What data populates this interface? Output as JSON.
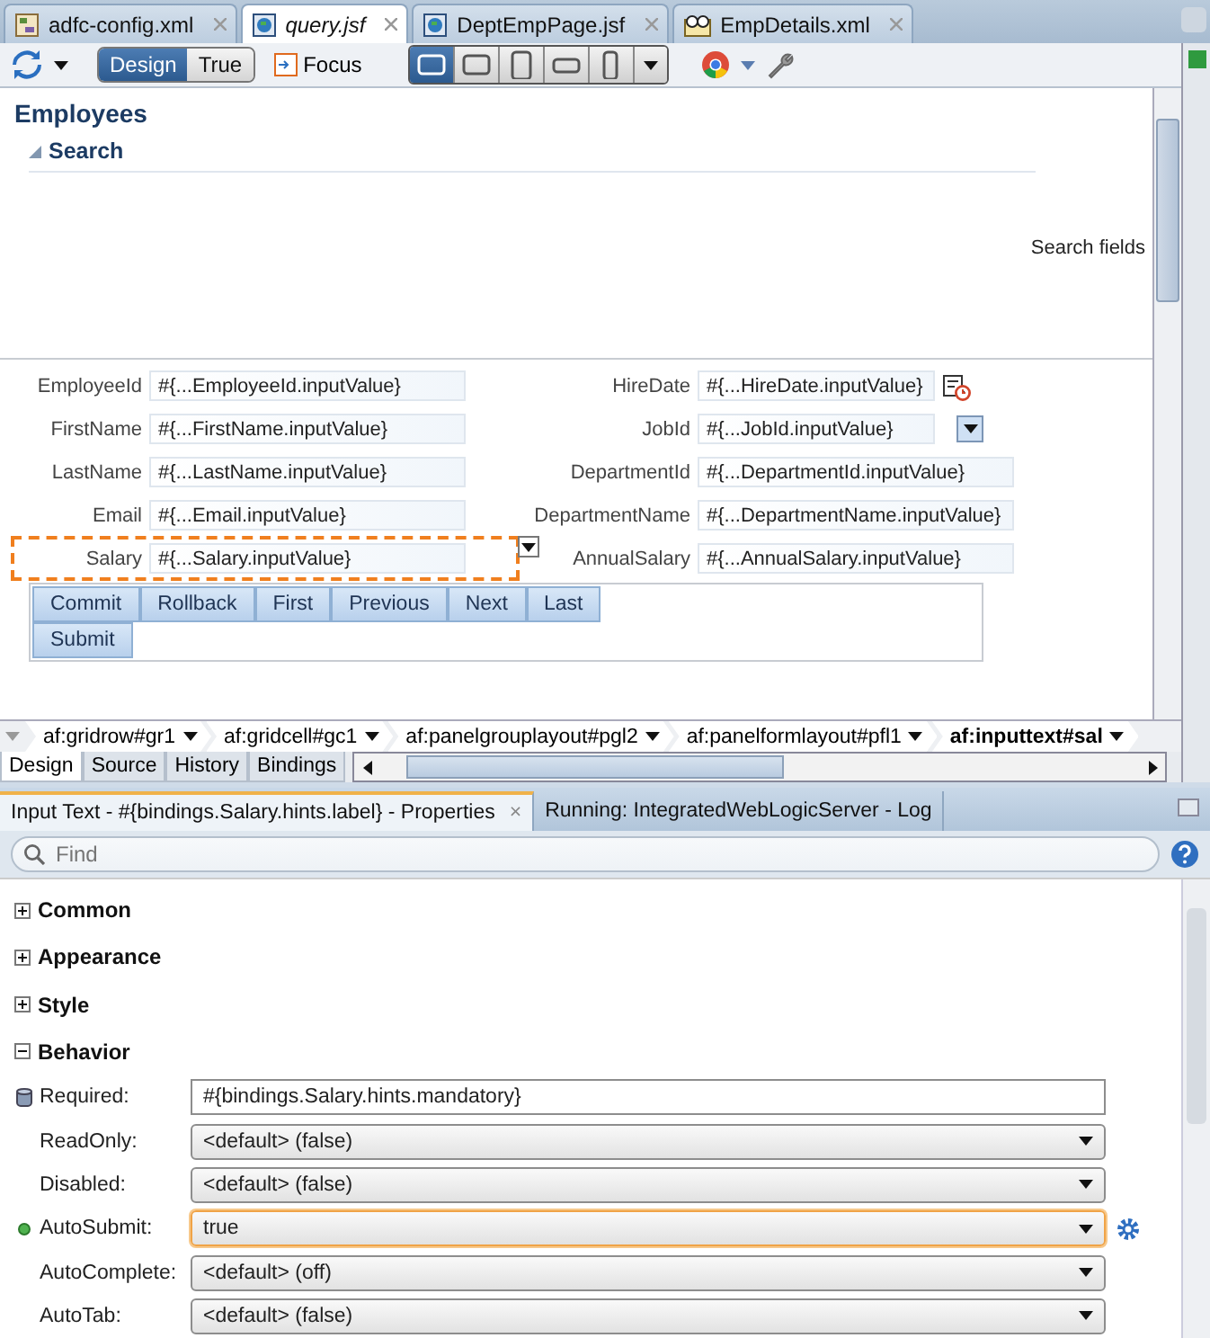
{
  "editor_tabs": [
    {
      "label": "adfc-config.xml",
      "kind": "config",
      "selected": false,
      "modified": false
    },
    {
      "label": "query.jsf",
      "kind": "page",
      "selected": true,
      "modified": true
    },
    {
      "label": "DeptEmpPage.jsf",
      "kind": "page",
      "selected": false,
      "modified": false
    },
    {
      "label": "EmpDetails.xml",
      "kind": "xml",
      "selected": false,
      "modified": false
    }
  ],
  "toolbar": {
    "mode_toggle": [
      {
        "label": "Design",
        "selected": true
      },
      {
        "label": "True",
        "selected": false
      }
    ],
    "focus_label": "Focus",
    "devices": [
      {
        "kind": "desktop",
        "selected": true
      },
      {
        "kind": "tablet-landscape",
        "selected": false
      },
      {
        "kind": "tablet",
        "selected": false
      },
      {
        "kind": "phone-landscape",
        "selected": false
      },
      {
        "kind": "phone",
        "selected": false
      }
    ]
  },
  "canvas": {
    "title": "Employees",
    "search_header": "Search",
    "search_hint": "Search fields",
    "left_fields": [
      {
        "label": "EmployeeId",
        "value": "#{...EmployeeId.inputValue}",
        "selected": false
      },
      {
        "label": "FirstName",
        "value": "#{...FirstName.inputValue}",
        "selected": false
      },
      {
        "label": "LastName",
        "value": "#{...LastName.inputValue}",
        "selected": false
      },
      {
        "label": "Email",
        "value": "#{...Email.inputValue}",
        "selected": false
      },
      {
        "label": "Salary",
        "value": "#{...Salary.inputValue}",
        "selected": true
      }
    ],
    "right_fields": [
      {
        "label": "HireDate",
        "value": "#{...HireDate.inputValue}",
        "kind": "date",
        "selected": false
      },
      {
        "label": "JobId",
        "value": "#{...JobId.inputValue}",
        "kind": "choice",
        "selected": false
      },
      {
        "label": "DepartmentId",
        "value": "#{...DepartmentId.inputValue}",
        "kind": "text",
        "selected": false
      },
      {
        "label": "DepartmentName",
        "value": "#{...DepartmentName.inputValue}",
        "kind": "text",
        "selected": false
      },
      {
        "label": "AnnualSalary",
        "value": "#{...AnnualSalary.inputValue}",
        "kind": "text",
        "selected": false
      }
    ],
    "buttons": [
      "Commit",
      "Rollback",
      "First",
      "Previous",
      "Next",
      "Last",
      "Submit"
    ]
  },
  "breadcrumbs": [
    {
      "label": "af:gridrow#gr1",
      "selected": false
    },
    {
      "label": "af:gridcell#gc1",
      "selected": false
    },
    {
      "label": "af:panelgrouplayout#pgl2",
      "selected": false
    },
    {
      "label": "af:panelformlayout#pfl1",
      "selected": false
    },
    {
      "label": "af:inputtext#sal",
      "selected": true
    }
  ],
  "view_tabs": [
    {
      "label": "Design",
      "selected": true
    },
    {
      "label": "Source",
      "selected": false
    },
    {
      "label": "History",
      "selected": false
    },
    {
      "label": "Bindings",
      "selected": false
    }
  ],
  "panel_tabs": [
    {
      "label": "Input Text - #{bindings.Salary.hints.label} - Properties",
      "selected": true,
      "close": "×"
    },
    {
      "label": "Running: IntegratedWebLogicServer - Log",
      "selected": false
    }
  ],
  "find": {
    "placeholder": "Find"
  },
  "sections": [
    {
      "title": "Common",
      "expanded": false
    },
    {
      "title": "Appearance",
      "expanded": false
    },
    {
      "title": "Style",
      "expanded": false
    },
    {
      "title": "Behavior",
      "expanded": true,
      "properties": [
        {
          "name": "Required:",
          "value": "#{bindings.Salary.hints.mandatory}",
          "kind": "text",
          "bound": true,
          "modified": false,
          "focused": false,
          "action": false
        },
        {
          "name": "ReadOnly:",
          "value": "<default> (false)",
          "kind": "select",
          "bound": false,
          "modified": false,
          "focused": false,
          "action": false
        },
        {
          "name": "Disabled:",
          "value": "<default> (false)",
          "kind": "select",
          "bound": false,
          "modified": false,
          "focused": false,
          "action": false
        },
        {
          "name": "AutoSubmit:",
          "value": "true",
          "kind": "select",
          "bound": false,
          "modified": true,
          "focused": true,
          "action": true
        },
        {
          "name": "AutoComplete:",
          "value": "<default> (off)",
          "kind": "select",
          "bound": false,
          "modified": false,
          "focused": false,
          "action": false
        },
        {
          "name": "AutoTab:",
          "value": "<default> (false)",
          "kind": "select",
          "bound": false,
          "modified": false,
          "focused": false,
          "action": false
        }
      ]
    }
  ]
}
